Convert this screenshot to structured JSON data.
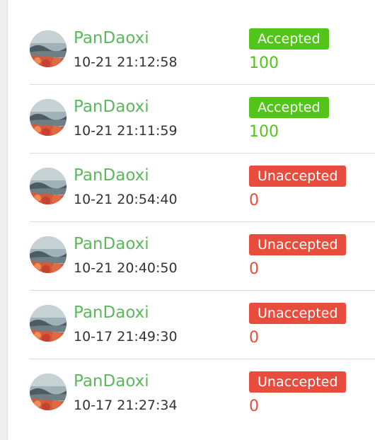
{
  "colors": {
    "accepted": "#52c41a",
    "unaccepted": "#e74c3c",
    "username": "#5cb85c"
  },
  "records": [
    {
      "username": "PanDaoxi",
      "time": "10-21 21:12:58",
      "status": "Accepted",
      "score": "100"
    },
    {
      "username": "PanDaoxi",
      "time": "10-21 21:11:59",
      "status": "Accepted",
      "score": "100"
    },
    {
      "username": "PanDaoxi",
      "time": "10-21 20:54:40",
      "status": "Unaccepted",
      "score": "0"
    },
    {
      "username": "PanDaoxi",
      "time": "10-21 20:40:50",
      "status": "Unaccepted",
      "score": "0"
    },
    {
      "username": "PanDaoxi",
      "time": "10-17 21:49:30",
      "status": "Unaccepted",
      "score": "0"
    },
    {
      "username": "PanDaoxi",
      "time": "10-17 21:27:34",
      "status": "Unaccepted",
      "score": "0"
    }
  ]
}
